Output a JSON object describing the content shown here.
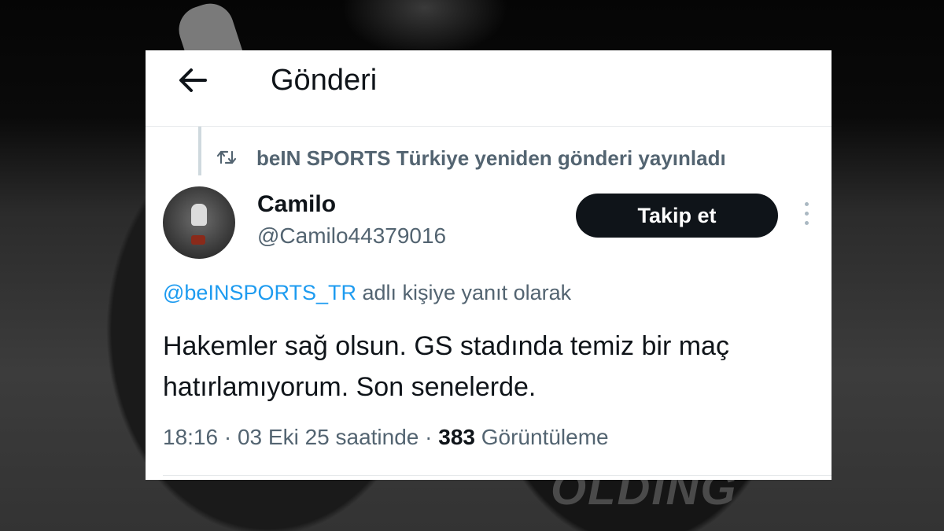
{
  "header": {
    "title": "Gönderi",
    "back_icon": "arrow-left-icon"
  },
  "retweet": {
    "icon": "retweet-icon",
    "text": "beIN SPORTS Türkiye yeniden gönderi yayınladı"
  },
  "author": {
    "name": "Camilo",
    "handle": "@Camilo44379016",
    "follow_label": "Takip et"
  },
  "reply": {
    "mention": "@beINSPORTS_TR",
    "suffix": "adlı kişiye yanıt olarak"
  },
  "tweet": {
    "text": "Hakemler sağ olsun. GS stadında temiz bir maç hatırlamıyorum. Son senelerde."
  },
  "meta": {
    "time": "18:16",
    "sep1": "·",
    "date": "03 Eki 25 saatinde",
    "sep2": "·",
    "views_count": "383",
    "views_label": "Görüntüleme"
  },
  "background": {
    "word": "OLDING"
  },
  "colors": {
    "text_primary": "#0f1419",
    "text_secondary": "#536471",
    "link": "#1d9bf0",
    "button_bg": "#0f1419"
  }
}
